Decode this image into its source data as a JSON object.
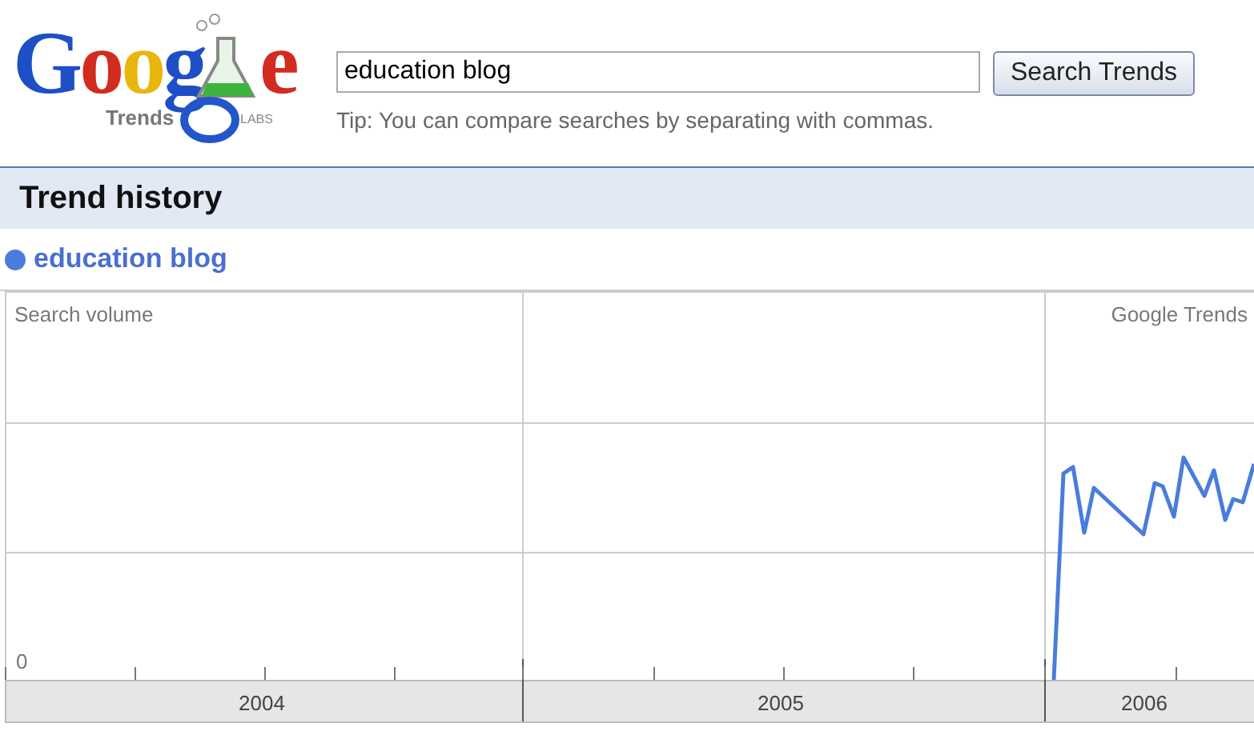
{
  "logo": {
    "word_start": "Goog",
    "word_end": "e",
    "sub": "Trends",
    "badge": "LABS"
  },
  "search": {
    "value": "education blog"
  },
  "search_button": "Search Trends",
  "tip": "Tip: You can compare searches by separating with commas.",
  "section_title": "Trend history",
  "legend": {
    "label": "education blog",
    "color": "#4a7ddb"
  },
  "chart": {
    "y_label": "Search volume",
    "credit": "Google Trends",
    "zero_label": "0",
    "years": [
      "2004",
      "2005",
      "2006"
    ]
  }
}
